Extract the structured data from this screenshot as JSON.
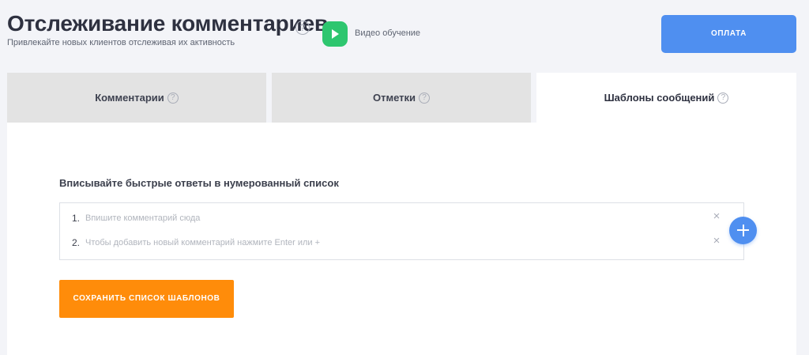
{
  "header": {
    "title": "Отслеживание комментариев",
    "title_help": "?",
    "subtitle": "Привлекайте новых клиентов отслеживая их активность",
    "video_label": "Видео обучение",
    "pay_label": "ОПЛАТА"
  },
  "tabs": [
    {
      "label": "Комментарии",
      "help": "?",
      "active": false
    },
    {
      "label": "Отметки",
      "help": "?",
      "active": false
    },
    {
      "label": "Шаблоны сообщений",
      "help": "?",
      "active": true
    }
  ],
  "templates": {
    "heading": "Вписывайте быстрые ответы в нумерованный список",
    "items": [
      {
        "number": "1.",
        "placeholder": "Впишите комментарий сюда",
        "close": "×"
      },
      {
        "number": "2.",
        "placeholder": "Чтобы добавить новый комментарий нажмите Enter или +",
        "close": "×"
      }
    ],
    "save_label": "СОХРАНИТЬ СПИСОК ШАБЛОНОВ"
  },
  "colors": {
    "primary": "#4f8ff0",
    "accent_orange": "#ff8c0a",
    "play_green": "#2ec66f",
    "inactive_tab": "#e3e3e3",
    "page_background": "#f3f4f8"
  },
  "icons": {
    "help": "question-circle-icon",
    "video": "play-icon",
    "remove": "close-icon",
    "add": "plus-icon"
  }
}
